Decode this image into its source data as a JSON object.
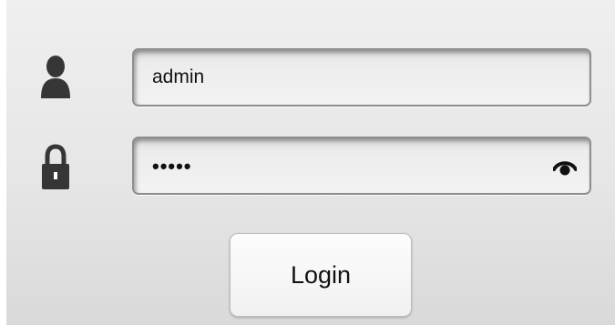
{
  "username": {
    "icon": "user-icon",
    "value": "admin"
  },
  "password": {
    "icon": "lock-icon",
    "value": "•••••",
    "toggle_icon": "eye-icon"
  },
  "login_button": {
    "label": "Login"
  }
}
